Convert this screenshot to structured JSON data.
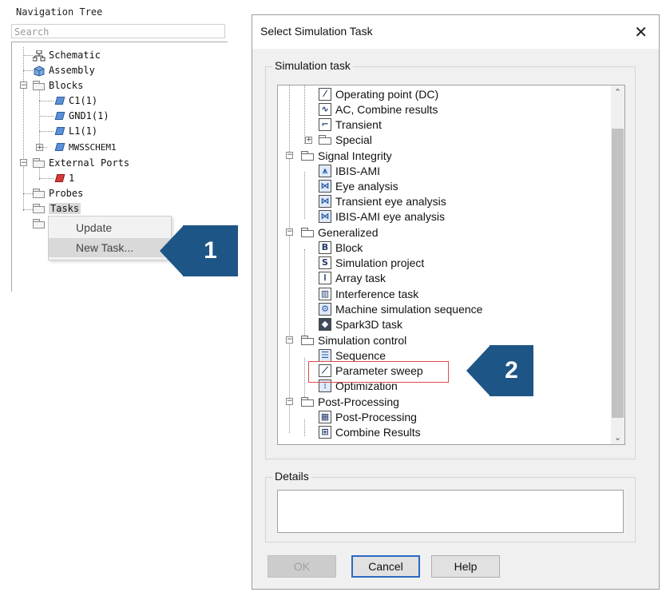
{
  "nav_tree": {
    "title": "Navigation Tree",
    "search_placeholder": "Search",
    "items": {
      "schematic": "Schematic",
      "assembly": "Assembly",
      "blocks": "Blocks",
      "c1": "C1(1)",
      "gnd1": "GND1(1)",
      "l1": "L1(1)",
      "mwsschem1": "MWSSCHEM1",
      "external_ports": "External Ports",
      "port1": "1",
      "probes": "Probes",
      "tasks": "Tasks"
    },
    "context_menu": {
      "update": "Update",
      "new_task": "New Task..."
    }
  },
  "callouts": {
    "one": "1",
    "two": "2"
  },
  "dialog": {
    "title": "Select Simulation Task",
    "close_glyph": "✕",
    "task_group_label": "Simulation task",
    "details_label": "Details",
    "tasks": {
      "operating_point": "Operating point (DC)",
      "ac_combine": "AC, Combine results",
      "transient": "Transient",
      "special": "Special",
      "signal_integrity": "Signal Integrity",
      "ibis_ami": "IBIS-AMI",
      "eye_analysis": "Eye analysis",
      "transient_eye": "Transient eye analysis",
      "ibis_ami_eye": "IBIS-AMI eye analysis",
      "generalized": "Generalized",
      "block": "Block",
      "simulation_project": "Simulation project",
      "array_task": "Array task",
      "interference_task": "Interference task",
      "machine_sequence": "Machine simulation sequence",
      "spark3d": "Spark3D task",
      "simulation_control": "Simulation control",
      "sequence": "Sequence",
      "parameter_sweep": "Parameter sweep",
      "optimization": "Optimization",
      "post_processing_group": "Post-Processing",
      "post_processing": "Post-Processing",
      "combine_results": "Combine Results"
    },
    "buttons": {
      "ok": "OK",
      "cancel": "Cancel",
      "help": "Help"
    }
  }
}
